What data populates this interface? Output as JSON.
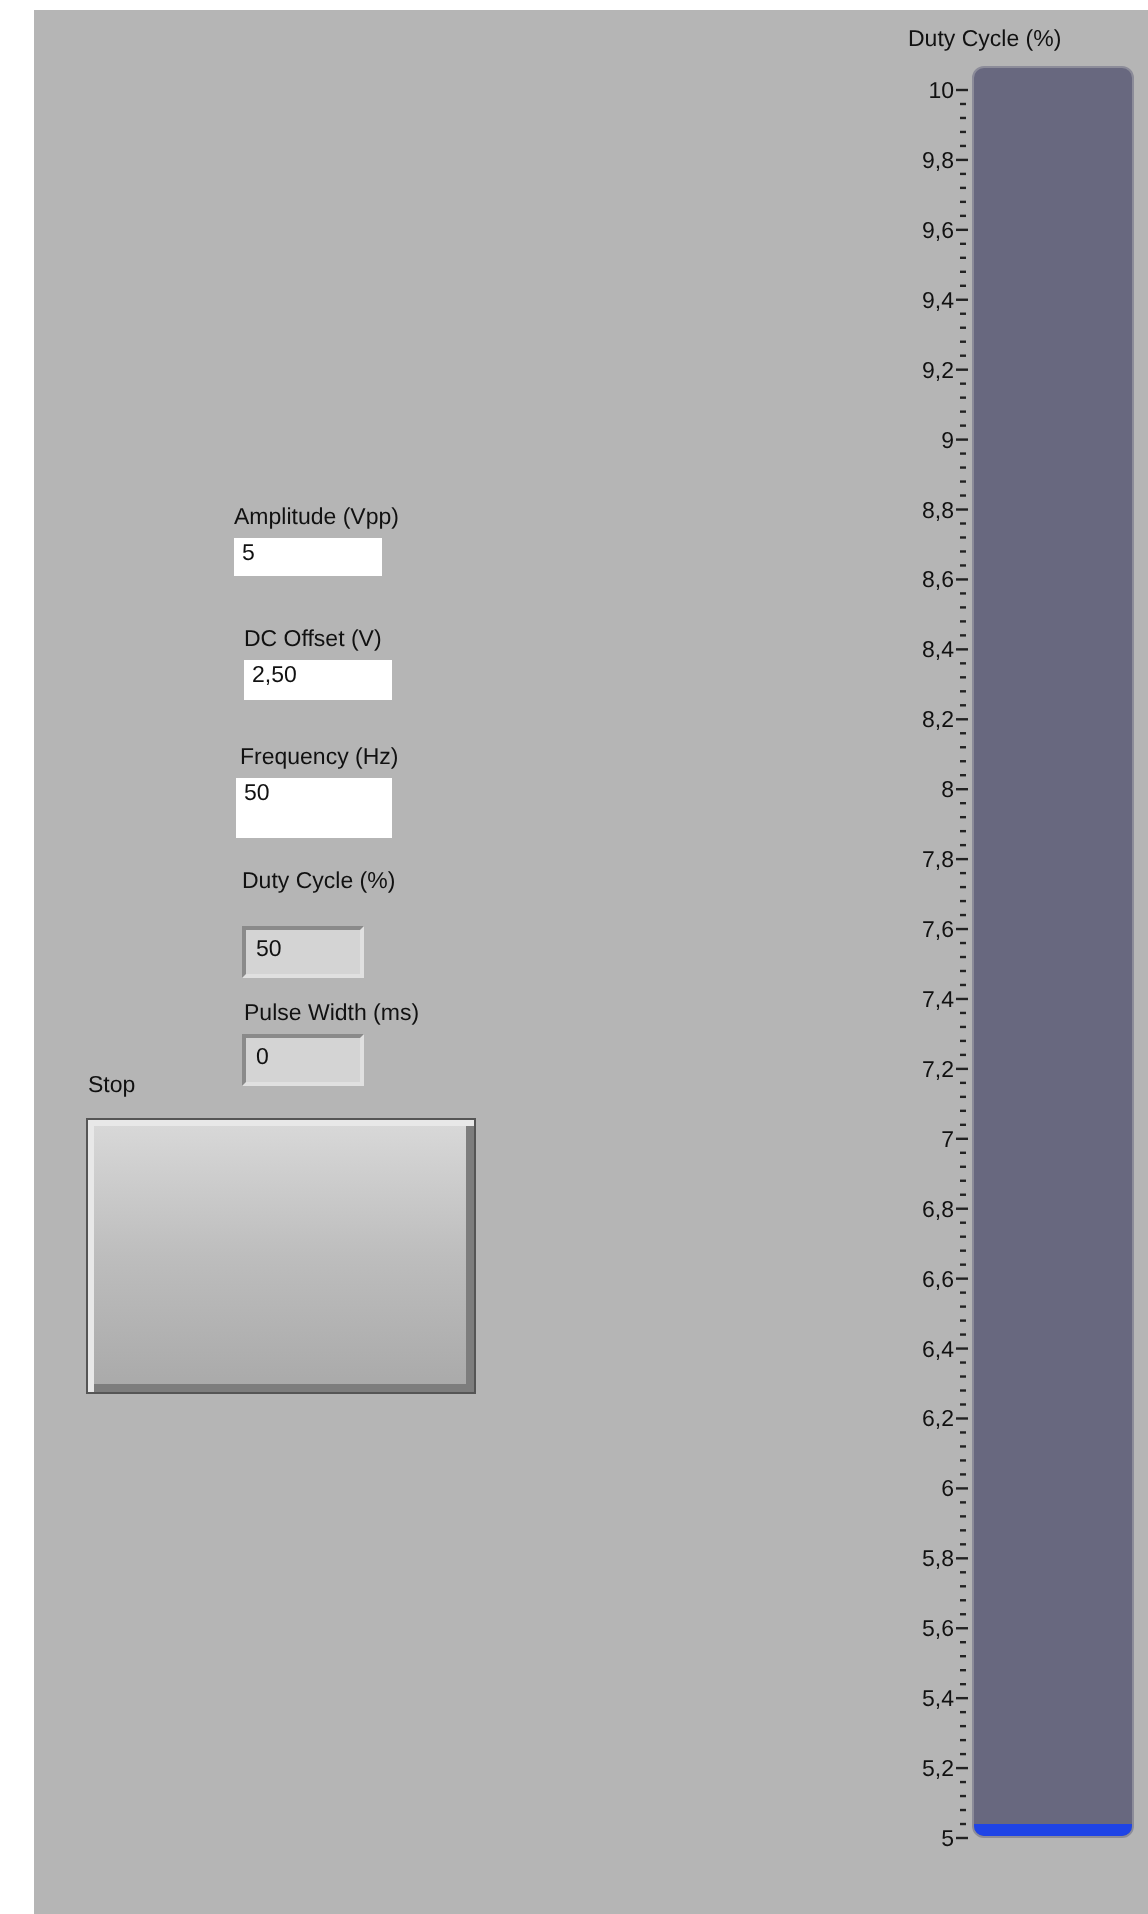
{
  "controls": [
    {
      "label": "Amplitude (Vpp)",
      "value": "5",
      "kind": "input"
    },
    {
      "label": "DC Offset (V)",
      "value": "2,50",
      "kind": "input"
    },
    {
      "label": "Frequency (Hz)",
      "value": "50",
      "kind": "input"
    },
    {
      "label": "Duty Cycle (%)",
      "value": "50",
      "kind": "indicator"
    },
    {
      "label": "Pulse Width (ms)",
      "value": "0",
      "kind": "indicator"
    }
  ],
  "stop": {
    "label": "Stop"
  },
  "tank": {
    "label": "Duty Cycle (%)",
    "level": 0.007,
    "ticks": [
      "10",
      "9,8",
      "9,6",
      "9,4",
      "9,2",
      "9",
      "8,8",
      "8,6",
      "8,4",
      "8,2",
      "8",
      "7,8",
      "7,6",
      "7,4",
      "7,2",
      "7",
      "6,8",
      "6,6",
      "6,4",
      "6,2",
      "6",
      "5,8",
      "5,6",
      "5,4",
      "5,2",
      "5"
    ]
  }
}
